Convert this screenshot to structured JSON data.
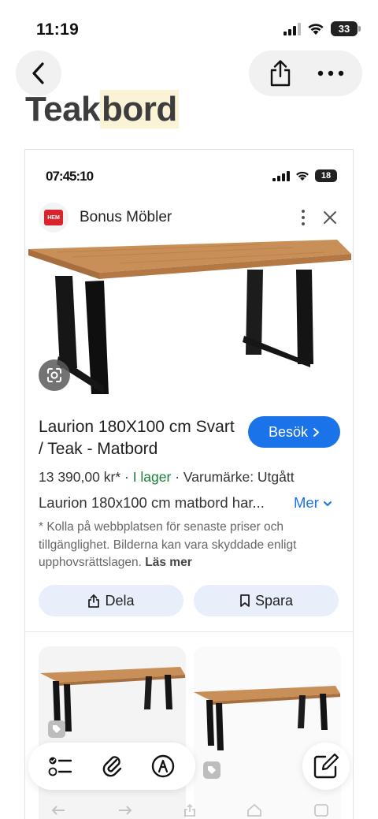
{
  "status_bar": {
    "time": "11:19",
    "battery": "33"
  },
  "note": {
    "title_plain": "Teak",
    "title_highlight": "bord"
  },
  "embedded": {
    "status_time": "07:45:10",
    "battery": "18",
    "source": {
      "name": "Bonus Möbler",
      "logo_text": "HEM"
    },
    "product": {
      "title": "Laurion 180X100 cm Svart / Teak - Matbord",
      "visit_label": "Besök",
      "price": "13 390,00 kr*",
      "separator": "·",
      "stock": "I lager",
      "brand": "Varumärke: Utgått",
      "description": "Laurion 180x100 cm matbord har...",
      "more_label": "Mer",
      "disclaimer": "* Kolla på webbplatsen för senaste priser och tillgänglighet. Bilderna kan vara skyddade enligt upphovsrättslagen.",
      "read_more": "Läs mer"
    },
    "actions": {
      "share_label": "Dela",
      "save_label": "Spara"
    }
  },
  "colors": {
    "accent": "#1a73e8",
    "stock_green": "#188038",
    "highlight": "#fbf3d5",
    "tabletop": "#c98f58",
    "legs": "#161616"
  },
  "icons": {
    "back": "chevron-left-icon",
    "share": "share-icon",
    "more": "more-horizontal-icon",
    "checklist": "checklist-icon",
    "attach": "paperclip-icon",
    "markup": "markup-pen-icon",
    "compose": "compose-icon"
  }
}
